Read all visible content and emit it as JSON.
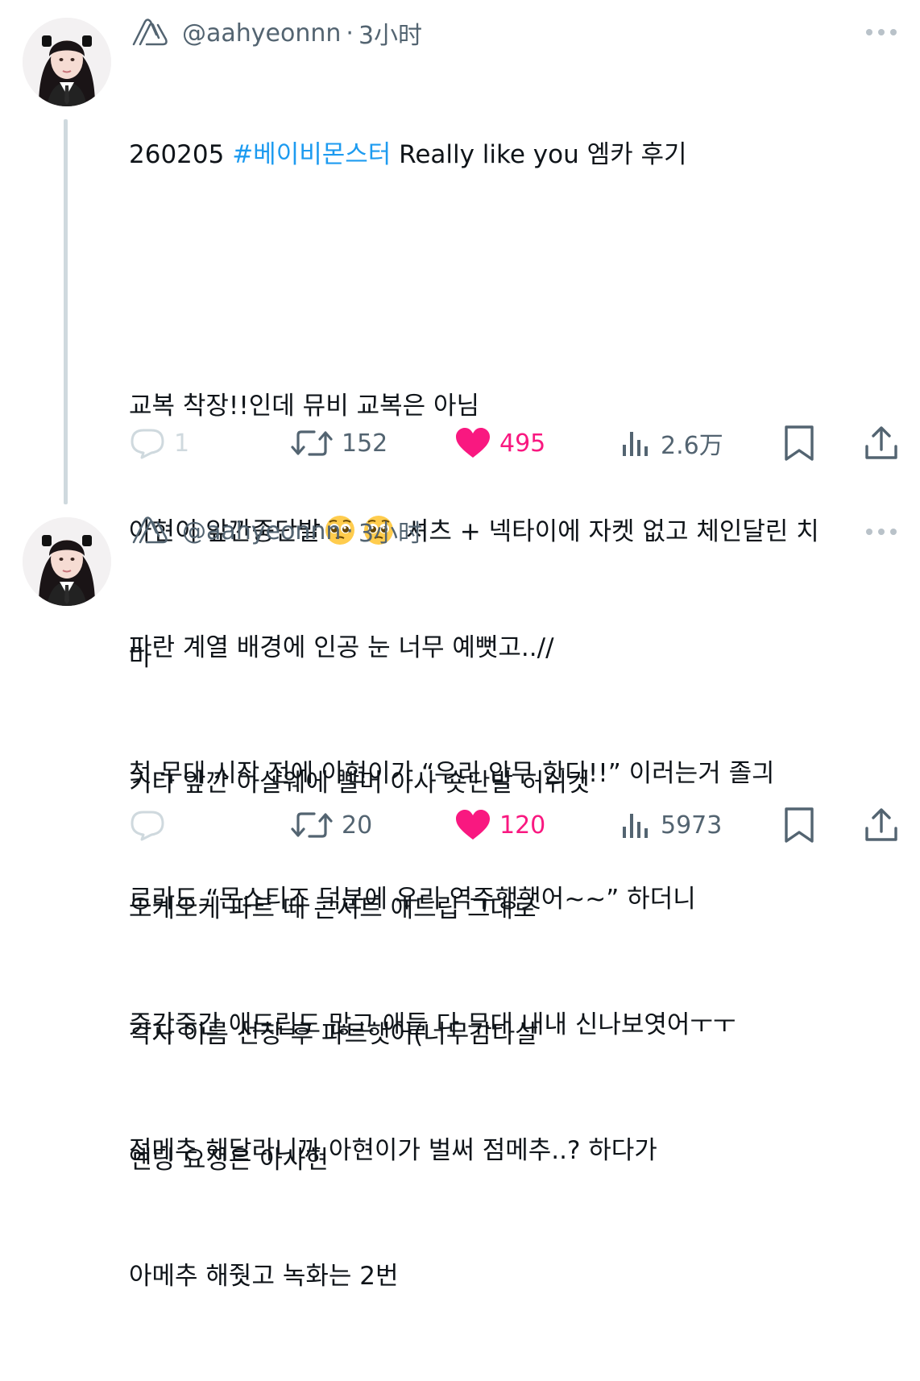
{
  "tweets": [
    {
      "handle": "@aahyeonnn",
      "separator": "·",
      "time": "3小时",
      "lines": [
        {
          "parts": [
            {
              "text": "260205 ",
              "type": "text"
            },
            {
              "text": "#베이비몬스터",
              "type": "hashtag"
            },
            {
              "text": " Really like you 엠카 후기",
              "type": "text"
            }
          ]
        },
        {
          "text": ""
        },
        {
          "text": "교복 착장!!인데 뮤비 교복은 아님"
        },
        {
          "text_before": "아현이 앞깐중단발",
          "emoji": "pleading-face",
          "text_after": " 셔츠 + 넥타이에 자켓 없고 체인달린 치"
        },
        {
          "text": "마"
        },
        {
          "text": "키타 앞깐 아살웨에 빨머 아사 숏단발 허쉬컷"
        },
        {
          "text": "오케오케 파트 때 콘서트 애드립 그대로"
        },
        {
          "text": "각자 이름 선창 후 파트햇어(너무감다살"
        },
        {
          "text": "엔딩 요정은 아사현"
        }
      ],
      "reply_count": "1",
      "retweet_count": "152",
      "like_count": "495",
      "view_count": "2.6万",
      "icons": [
        "paperclip-logo-icon",
        "more-icon",
        "reply-icon",
        "retweet-icon",
        "heart-icon",
        "views-icon",
        "bookmark-icon",
        "share-icon"
      ]
    },
    {
      "handle": "@aahyeonnn",
      "separator": "·",
      "time": "3小时",
      "lines": [
        {
          "text": "파란 계열 배경에 인공 눈 너무 예뻣고..//"
        },
        {
          "text": "첫 무대 시작 전에 아현이가 “우리 안무 한다!!” 이러는거 졸긔"
        },
        {
          "text": "로라도 “몬스티즈 덕분에 우리 역주행햇어~~” 하더니"
        },
        {
          "text": "중간중간 애드립도 많고 애들 다 무대 내내 신나보엿어ㅜㅜ"
        },
        {
          "text": "점메추 해달라니까 아현이가 벌써 점메추..? 하다가"
        },
        {
          "text": "아메추 해줫고 녹화는 2번"
        }
      ],
      "reply_count": "",
      "retweet_count": "20",
      "like_count": "120",
      "view_count": "5973"
    }
  ],
  "colors": {
    "text": "#0f1419",
    "secondary": "#536471",
    "hashtag": "#1d9bf0",
    "like": "#f91880",
    "thread_line": "#cfd9de",
    "reply_faded": "#cfd9de"
  }
}
